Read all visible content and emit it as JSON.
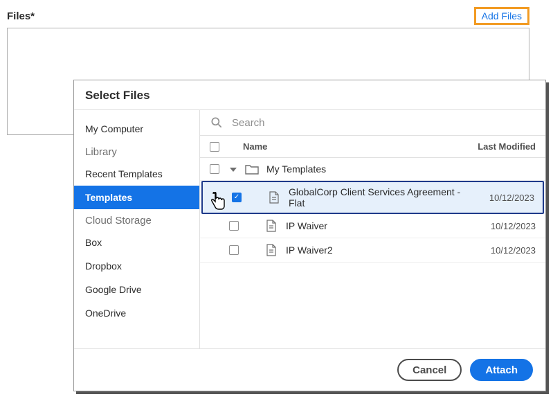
{
  "files_label": "Files*",
  "add_files_label": "Add Files",
  "dialog": {
    "title": "Select Files",
    "search_placeholder": "Search",
    "columns": {
      "name": "Name",
      "modified": "Last Modified"
    },
    "sidebar": {
      "sources": [
        {
          "label": "My Computer",
          "active": false
        }
      ],
      "library_label": "Library",
      "library": [
        {
          "label": "Recent Templates",
          "active": false
        },
        {
          "label": "Templates",
          "active": true
        }
      ],
      "cloud_label": "Cloud Storage",
      "cloud": [
        {
          "label": "Box"
        },
        {
          "label": "Dropbox"
        },
        {
          "label": "Google Drive"
        },
        {
          "label": "OneDrive"
        }
      ]
    },
    "folder": {
      "name": "My Templates"
    },
    "files": [
      {
        "name": "GlobalCorp Client Services Agreement - Flat",
        "date": "10/12/2023",
        "checked": true
      },
      {
        "name": "IP Waiver",
        "date": "10/12/2023",
        "checked": false
      },
      {
        "name": "IP Waiver2",
        "date": "10/12/2023",
        "checked": false
      }
    ],
    "cancel_label": "Cancel",
    "attach_label": "Attach"
  }
}
